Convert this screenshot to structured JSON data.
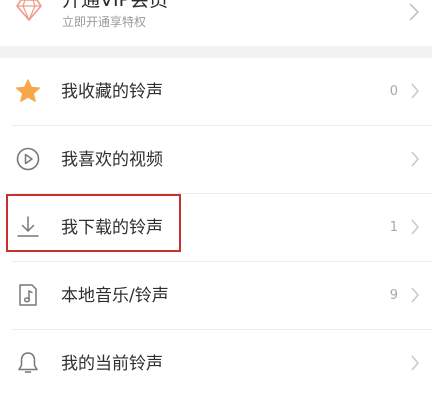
{
  "vip": {
    "title": "开通VIP会员",
    "subtitle": "立即开通享特权",
    "icon": "diamond-icon",
    "icon_color": "#f09a8a"
  },
  "menu": {
    "items": [
      {
        "id": "favorite-ringtones",
        "label": "我收藏的铃声",
        "count": "0",
        "icon": "star-icon"
      },
      {
        "id": "liked-videos",
        "label": "我喜欢的视频",
        "count": "",
        "icon": "play-circle-icon"
      },
      {
        "id": "downloaded-ringtones",
        "label": "我下载的铃声",
        "count": "1",
        "icon": "download-icon",
        "highlighted": true
      },
      {
        "id": "local-music",
        "label": "本地音乐/铃声",
        "count": "9",
        "icon": "music-file-icon"
      },
      {
        "id": "current-ringtone",
        "label": "我的当前铃声",
        "count": "",
        "icon": "bell-icon"
      }
    ]
  },
  "colors": {
    "star": "#f7a64a",
    "icon_gray": "#777777",
    "highlight": "#c9312c"
  }
}
